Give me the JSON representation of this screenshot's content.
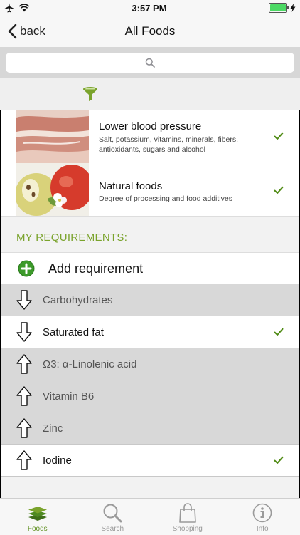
{
  "status_bar": {
    "time": "3:57 PM"
  },
  "nav": {
    "back_label": "back",
    "title": "All Foods"
  },
  "criteria": [
    {
      "title": "Lower blood pressure",
      "subtitle": "Salt, potassium, vitamins, minerals, fibers, antioxidants, sugars and alcohol",
      "checked": true
    },
    {
      "title": "Natural foods",
      "subtitle": "Degree of processing and food additives",
      "checked": true
    }
  ],
  "requirements_header": "MY REQUIREMENTS:",
  "add_requirement_label": "Add requirement",
  "requirements": [
    {
      "label": "Carbohydrates",
      "direction": "down",
      "selected": false
    },
    {
      "label": "Saturated fat",
      "direction": "down",
      "selected": true
    },
    {
      "label": "Ω3: α-Linolenic acid",
      "direction": "up",
      "selected": false
    },
    {
      "label": "Vitamin B6",
      "direction": "up",
      "selected": false
    },
    {
      "label": "Zinc",
      "direction": "up",
      "selected": false
    },
    {
      "label": "Iodine",
      "direction": "up",
      "selected": true
    }
  ],
  "tabs": [
    {
      "label": "Foods",
      "icon": "layers-icon",
      "active": true
    },
    {
      "label": "Search",
      "icon": "magnifier-icon",
      "active": false
    },
    {
      "label": "Shopping",
      "icon": "shopping-bag-icon",
      "active": false
    },
    {
      "label": "Info",
      "icon": "info-icon",
      "active": false
    }
  ],
  "colors": {
    "accent_green": "#7aa32c",
    "check_green": "#4e8a12",
    "selected_row": "#ffffff",
    "unselected_row": "#d8d8d8"
  }
}
